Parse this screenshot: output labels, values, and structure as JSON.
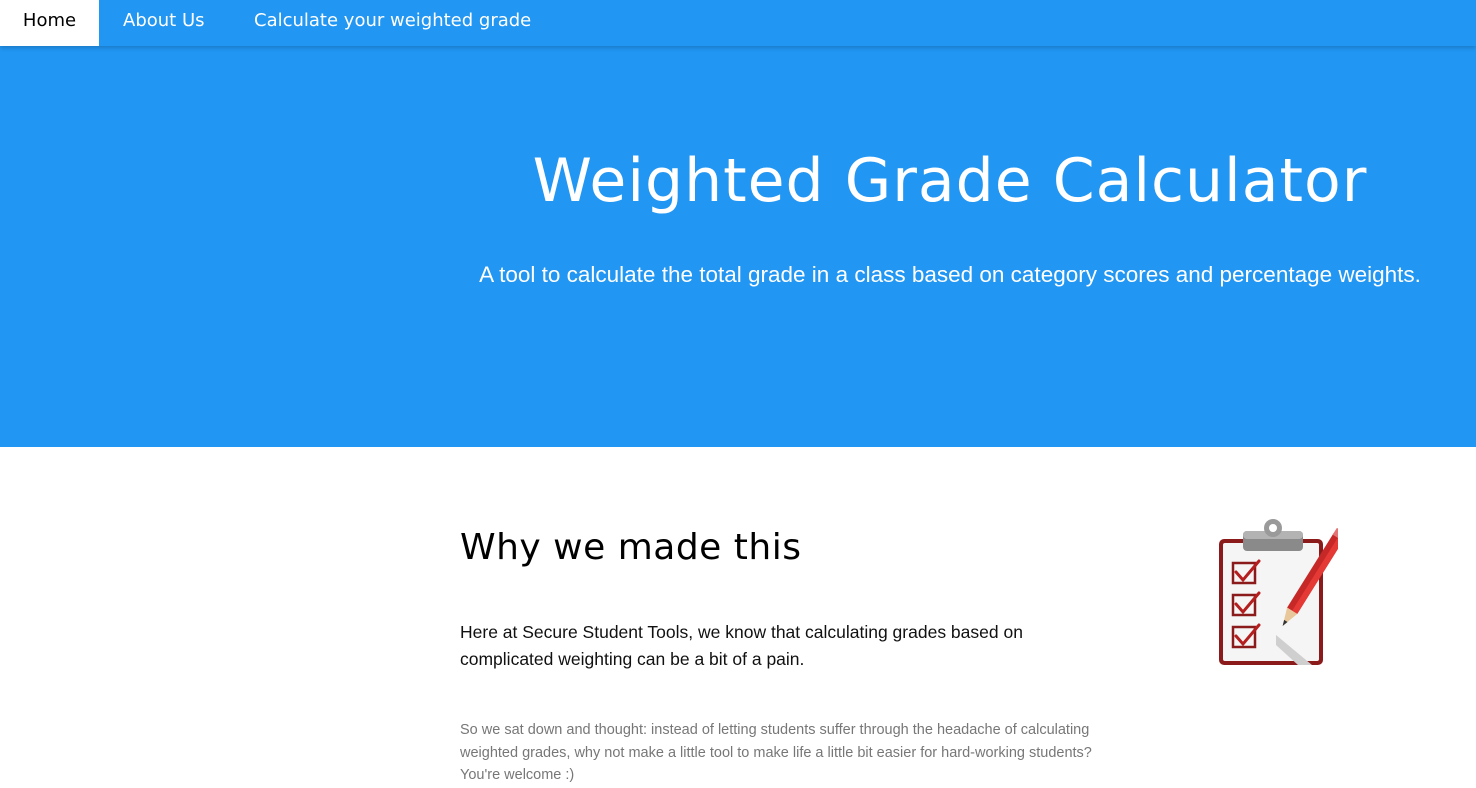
{
  "nav": {
    "items": [
      {
        "label": "Home"
      },
      {
        "label": "About Us"
      },
      {
        "label": "Calculate your weighted grade"
      }
    ]
  },
  "hero": {
    "title": "Weighted Grade Calculator",
    "subtitle": "A tool to calculate the total grade in a class based on category scores and percentage weights."
  },
  "about": {
    "heading": "Why we made this",
    "lead": "Here at Secure Student Tools, we know that calculating grades based on complicated weighting can be a bit of a pain.",
    "body": "So we sat down and thought: instead of letting students suffer through the headache of calculating weighted grades, why not make a little tool to make life a little bit easier for hard-working students? You're welcome :)",
    "image_icon": "clipboard-checklist-icon"
  },
  "colors": {
    "primary": "#2196f3",
    "nav_active_bg": "#ffffff",
    "body_text": "#777777"
  }
}
